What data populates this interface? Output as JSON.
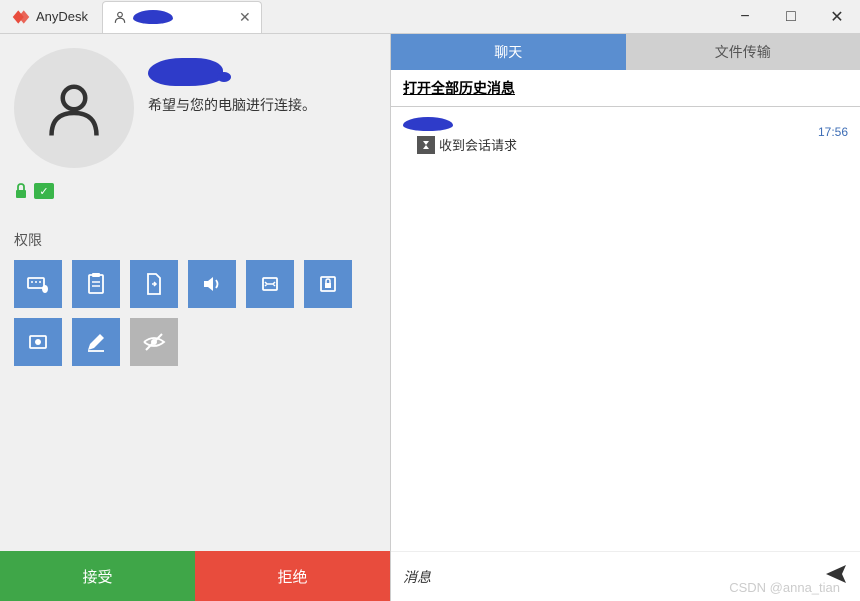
{
  "app": {
    "name": "AnyDesk"
  },
  "tab": {
    "label_redacted": true
  },
  "window_controls": {
    "minimize": "−",
    "maximize": "□",
    "close": "✕"
  },
  "profile": {
    "remote_name_redacted": true,
    "wants_text": "希望与您的电脑进行连接。"
  },
  "permissions": {
    "title": "权限",
    "items": [
      {
        "name": "keyboard-mouse",
        "on": true
      },
      {
        "name": "clipboard",
        "on": true
      },
      {
        "name": "file-transfer",
        "on": true
      },
      {
        "name": "audio",
        "on": true
      },
      {
        "name": "switch-sides",
        "on": true
      },
      {
        "name": "lock",
        "on": true
      },
      {
        "name": "record",
        "on": true
      },
      {
        "name": "draw",
        "on": true
      },
      {
        "name": "privacy",
        "on": false
      }
    ]
  },
  "actions": {
    "accept": "接受",
    "reject": "拒绝"
  },
  "chat": {
    "tabs": {
      "chat": "聊天",
      "file": "文件传输"
    },
    "history_link": "打开全部历史消息",
    "messages": [
      {
        "sender_redacted": true,
        "text": "收到会话请求",
        "time": "17:56"
      }
    ],
    "input_placeholder": "消息"
  },
  "watermark": "CSDN @anna_tian"
}
